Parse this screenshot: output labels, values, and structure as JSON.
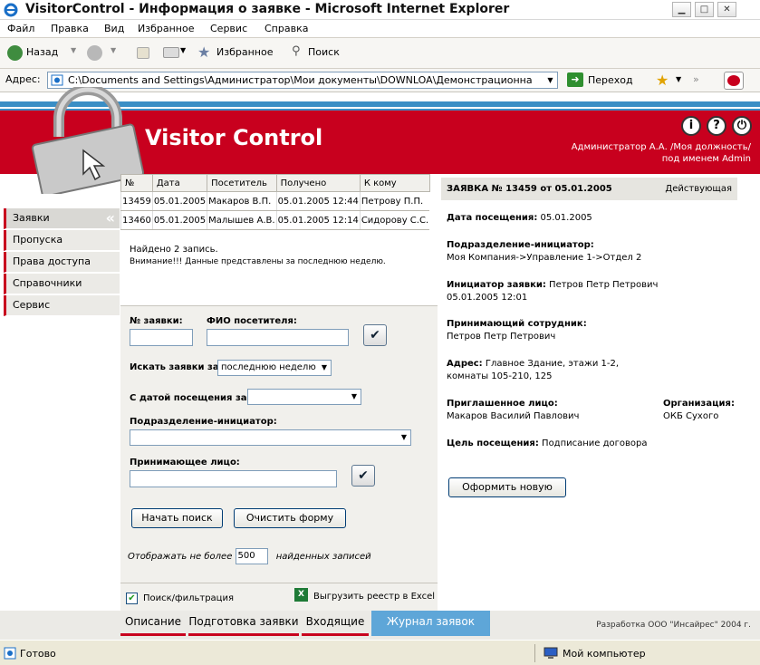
{
  "window": {
    "title": "VisitorControl - Информация о заявке - Microsoft Internet Explorer"
  },
  "menubar": [
    "Файл",
    "Правка",
    "Вид",
    "Избранное",
    "Сервис",
    "Справка"
  ],
  "toolbar": {
    "back": "Назад",
    "favorites": "Избранное",
    "search": "Поиск"
  },
  "address": {
    "label": "Адрес:",
    "url": "C:\\Documents and Settings\\Администратор\\Мои документы\\DOWNLOA\\Демонстрационна",
    "go": "Переход"
  },
  "header": {
    "app_title": "Visitor Control",
    "user_line1": "Администратор А.А. /Моя должность/",
    "user_line2": "под именем Admin",
    "buttons": [
      "i",
      "?",
      "⏻"
    ]
  },
  "sidebar": {
    "items": [
      {
        "label": "Заявки"
      },
      {
        "label": "Пропуска"
      },
      {
        "label": "Права доступа"
      },
      {
        "label": "Справочники"
      },
      {
        "label": "Сервис"
      }
    ]
  },
  "results": {
    "columns": [
      "№",
      "Дата",
      "Посетитель",
      "Получено",
      "К кому"
    ],
    "rows": [
      [
        "13459",
        "05.01.2005",
        "Макаров В.П.",
        "05.01.2005 12:44",
        "Петрову П.П."
      ],
      [
        "13460",
        "05.01.2005",
        "Малышев А.В.",
        "05.01.2005 12:14",
        "Сидорову С.С."
      ]
    ],
    "found": "Найдено 2 запись.",
    "warning": "Внимание!!! Данные представлены за последнюю неделю."
  },
  "form": {
    "req_no_label": "№ заявки:",
    "visitor_label": "ФИО посетителя:",
    "search_period_label": "Искать заявки за:",
    "search_period_value": "последнюю неделю",
    "visit_date_label": "С датой посещения за:",
    "visit_date_value": "",
    "dept_label": "Подразделение-инициатор:",
    "dept_value": "",
    "host_label": "Принимающее лицо:",
    "start_search": "Начать поиск",
    "clear_form": "Очистить форму",
    "limit_prefix": "Отображать не более",
    "limit_value": "500",
    "limit_suffix": "найденных записей",
    "filter_label": "Поиск/фильтрация",
    "export_label": "Выгрузить реестр в Excel",
    "check_glyph": "✔"
  },
  "details": {
    "header": "ЗАЯВКА № 13459 от 05.01.2005",
    "status": "Действующая",
    "visit_date_label": "Дата посещения:",
    "visit_date": "05.01.2005",
    "dept_label": "Подразделение-инициатор:",
    "dept": "Моя Компания->Управление 1->Отдел 2",
    "initiator_label": "Инициатор заявки:",
    "initiator": "Петров  Петр  Петрович",
    "initiator_date": "05.01.2005 12:01",
    "host_label": "Принимающий сотрудник:",
    "host": "Петров  Петр  Петрович",
    "address_label": "Адрес:",
    "address_line1": "Главное Здание, этажи 1-2,",
    "address_line2": "комнаты 105-210, 125",
    "invited_label": "Приглашенное лицо:",
    "invited": "Макаров  Василий  Павлович",
    "org_label": "Организация:",
    "org": "ОКБ Сухого",
    "purpose_label": "Цель посещения:",
    "purpose": "Подписание договора",
    "new_button": "Оформить новую"
  },
  "tabs": [
    {
      "label": "Описание"
    },
    {
      "label": "Подготовка заявки"
    },
    {
      "label": "Входящие"
    },
    {
      "label": "Журнал заявок"
    }
  ],
  "footer": {
    "copyright": "Разработка ООО \"Инсайрес\" 2004 г."
  },
  "status": {
    "left": "Готово",
    "right": "Мой компьютер"
  },
  "colors": {
    "brand_red": "#c8001e",
    "accent_blue": "#3a8ec5",
    "active_tab": "#5ea6d8"
  }
}
